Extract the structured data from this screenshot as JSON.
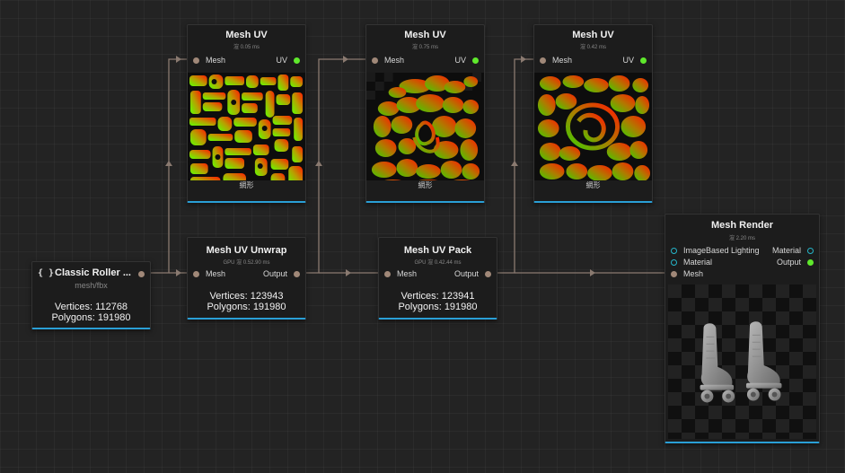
{
  "nodes": {
    "source": {
      "title": "Classic Roller ...",
      "subtitle": "mesh/fbx",
      "vertices": "Vertices: 112768",
      "polygons": "Polygons: 191980"
    },
    "uv1": {
      "title": "Mesh UV",
      "timing": "渲 0.05 ms",
      "in_label": "Mesh",
      "out_label": "UV",
      "image_label": "網形"
    },
    "uv2": {
      "title": "Mesh UV",
      "timing": "渲 0.75 ms",
      "in_label": "Mesh",
      "out_label": "UV",
      "image_label": "網形"
    },
    "uv3": {
      "title": "Mesh UV",
      "timing": "渲 0.42 ms",
      "in_label": "Mesh",
      "out_label": "UV",
      "image_label": "網形"
    },
    "unwrap": {
      "title": "Mesh UV Unwrap",
      "timing": "GPU 渲 0.52.90 ms",
      "in_label": "Mesh",
      "out_label": "Output",
      "vertices": "Vertices: 123943",
      "polygons": "Polygons: 191980"
    },
    "pack": {
      "title": "Mesh UV Pack",
      "timing": "GPU 渲 0.42.44 ms",
      "in_label": "Mesh",
      "out_label": "Output",
      "vertices": "Vertices: 123941",
      "polygons": "Polygons: 191980"
    },
    "render": {
      "title": "Mesh Render",
      "timing": "渲 2.20 ms",
      "inputs": [
        "ImageBased Lighting",
        "Material",
        "Mesh"
      ],
      "outputs": [
        "Material",
        "Output"
      ]
    }
  },
  "colors": {
    "accent": "#2a9fd6",
    "port_output": "#5fe82c",
    "port_input": "#a08878",
    "port_ring": "#25b5c9",
    "wire": "#8a7a70"
  },
  "icons": {
    "source_node": "braces-icon"
  }
}
